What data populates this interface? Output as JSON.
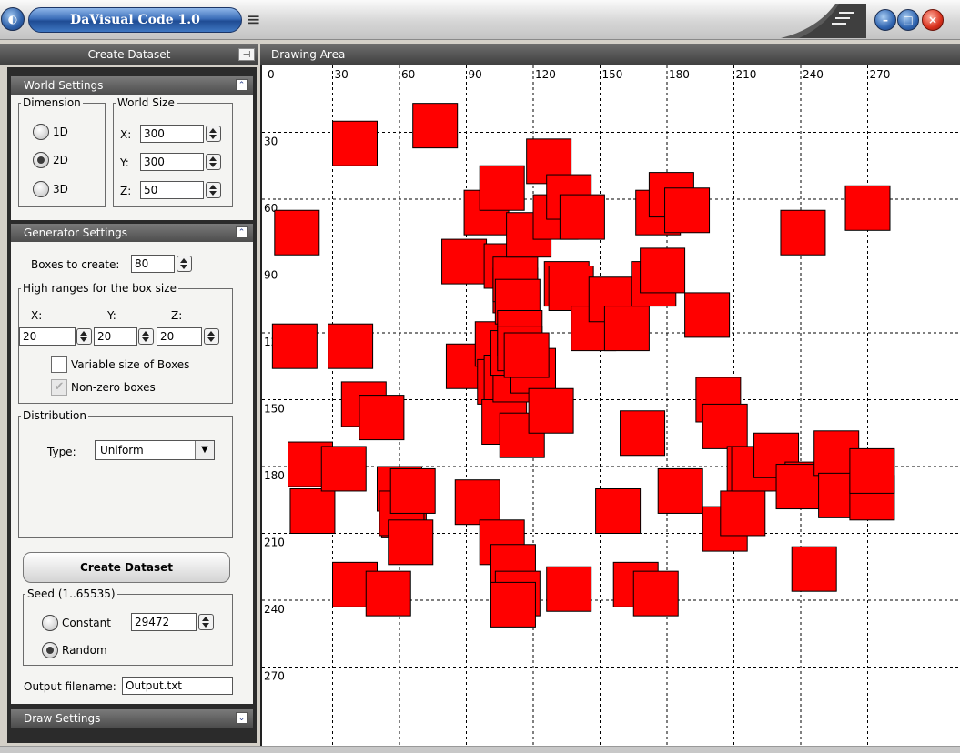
{
  "window": {
    "title": "DaVisual Code 1.0",
    "menu_icon": "hamburger-menu-icon",
    "buttons": [
      "minimize",
      "maximize",
      "close"
    ]
  },
  "left_panel": {
    "header": "Create Dataset",
    "pin_icon": "pin-icon",
    "world_settings": {
      "title": "World Settings",
      "dimension": {
        "legend": "Dimension",
        "options": [
          "1D",
          "2D",
          "3D"
        ],
        "selected": "2D"
      },
      "world_size": {
        "legend": "World Size",
        "x_label": "X:",
        "x": "300",
        "y_label": "Y:",
        "y": "300",
        "z_label": "Z:",
        "z": "50"
      }
    },
    "generator_settings": {
      "title": "Generator Settings",
      "boxes_label": "Boxes to create:",
      "boxes": "80",
      "high_ranges": {
        "legend": "High ranges for the box size",
        "x_label": "X:",
        "x": "20",
        "y_label": "Y:",
        "y": "20",
        "z_label": "Z:",
        "z": "20"
      },
      "variable_size_label": "Variable size of Boxes",
      "variable_size_checked": false,
      "non_zero_label": "Non-zero boxes",
      "non_zero_checked": true,
      "distribution": {
        "legend": "Distribution",
        "type_label": "Type:",
        "type": "Uniform"
      },
      "create_button": "Create Dataset",
      "seed": {
        "legend": "Seed (1..65535)",
        "constant_label": "Constant",
        "constant_value": "29472",
        "random_label": "Random",
        "selected": "Random"
      },
      "output_label": "Output filename:",
      "output_value": "Output.txt"
    },
    "draw_settings": {
      "title": "Draw Settings"
    }
  },
  "drawing_area": {
    "header": "Drawing Area",
    "axis_ticks_x": [
      "0",
      "30",
      "60",
      "90",
      "120",
      "150",
      "180",
      "210",
      "240",
      "270"
    ],
    "axis_ticks_y": [
      "30",
      "60",
      "90",
      "120",
      "150",
      "180",
      "210",
      "240",
      "270"
    ],
    "box_color": "#ff0000",
    "world_range": [
      0,
      300
    ],
    "boxes": [
      [
        4,
        65
      ],
      [
        11,
        190
      ],
      [
        3,
        116
      ],
      [
        10,
        169
      ],
      [
        25,
        171
      ],
      [
        30,
        223
      ],
      [
        28,
        116
      ],
      [
        30,
        25
      ],
      [
        34,
        142
      ],
      [
        42,
        148
      ],
      [
        45,
        227
      ],
      [
        50,
        180
      ],
      [
        52,
        192
      ],
      [
        51,
        191
      ],
      [
        55,
        204
      ],
      [
        56,
        181
      ],
      [
        66,
        17
      ],
      [
        79,
        78
      ],
      [
        81,
        125
      ],
      [
        85,
        186
      ],
      [
        89,
        56
      ],
      [
        94,
        115
      ],
      [
        95,
        132
      ],
      [
        96,
        45
      ],
      [
        97,
        150
      ],
      [
        98,
        80
      ],
      [
        96,
        204
      ],
      [
        98,
        130
      ],
      [
        101,
        215
      ],
      [
        103,
        227
      ],
      [
        101,
        232
      ],
      [
        102,
        91
      ],
      [
        102,
        131
      ],
      [
        102,
        86
      ],
      [
        103,
        96
      ],
      [
        101,
        119
      ],
      [
        104,
        110
      ],
      [
        105,
        156
      ],
      [
        110,
        127
      ],
      [
        104,
        117
      ],
      [
        107,
        120
      ],
      [
        108,
        66
      ],
      [
        117,
        33
      ],
      [
        118,
        145
      ],
      [
        120,
        58
      ],
      [
        126,
        49
      ],
      [
        125,
        88
      ],
      [
        126,
        225
      ],
      [
        127,
        90
      ],
      [
        132,
        58
      ],
      [
        137,
        108
      ],
      [
        145,
        95
      ],
      [
        148,
        190
      ],
      [
        152,
        108
      ],
      [
        159,
        155
      ],
      [
        156,
        223
      ],
      [
        164,
        88
      ],
      [
        166,
        56
      ],
      [
        165,
        227
      ],
      [
        168,
        82
      ],
      [
        172,
        48
      ],
      [
        176,
        181
      ],
      [
        179,
        55
      ],
      [
        188,
        102
      ],
      [
        193,
        140
      ],
      [
        196,
        152
      ],
      [
        196,
        198
      ],
      [
        207,
        171
      ],
      [
        204,
        191
      ],
      [
        209,
        171
      ],
      [
        219,
        165
      ],
      [
        231,
        65
      ],
      [
        233,
        178
      ],
      [
        236,
        216
      ],
      [
        229,
        179
      ],
      [
        246,
        164
      ],
      [
        248,
        183
      ],
      [
        260,
        54
      ],
      [
        262,
        184
      ],
      [
        262,
        172
      ]
    ]
  }
}
